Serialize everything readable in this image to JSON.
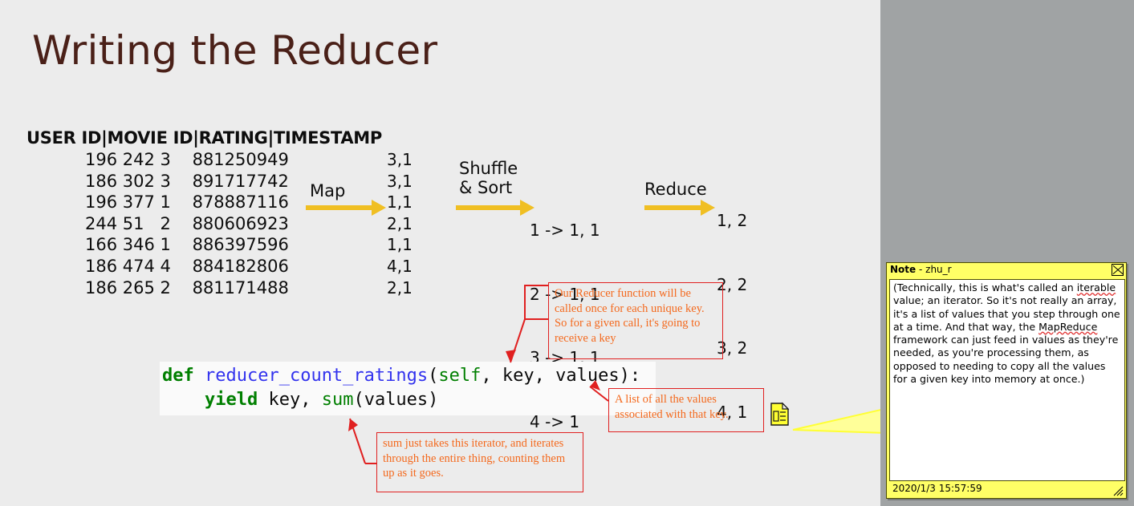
{
  "slide": {
    "title": "Writing the Reducer",
    "background_color": "#ececec",
    "title_color": "#4a2018"
  },
  "data_table": {
    "header": "USER ID|MOVIE ID|RATING|TIMESTAMP",
    "rows": [
      "196 242 3    881250949",
      "186 302 3    891717742",
      "196 377 1    878887116",
      "244 51   2    880606923",
      "166 346 1    886397596",
      "186 474 4    884182806",
      "186 265 2    881171488"
    ]
  },
  "pipeline": {
    "map_label": "Map",
    "shuffle_label": "Shuffle\n& Sort",
    "reduce_label": "Reduce",
    "arrow_color": "#f0bf23",
    "map_output": [
      "3,1",
      "3,1",
      "1,1",
      "2,1",
      "1,1",
      "4,1",
      "2,1"
    ],
    "shuffle_output": [
      "1 -> 1, 1",
      "2 -> 1, 1",
      "3 -> 1, 1",
      "4 -> 1"
    ],
    "reduce_output": [
      "1, 2",
      "2, 2",
      "3, 2",
      "4, 1"
    ]
  },
  "code": {
    "line1": {
      "def": "def",
      "fn": " reducer_count_ratings",
      "open": "(",
      "self": "self",
      "rest": ", key, values):"
    },
    "line2": {
      "indent": "    ",
      "yield": "yield",
      "mid": " key, ",
      "sum": "sum",
      "rest": "(values)"
    }
  },
  "annotations": [
    {
      "id": "note1",
      "text": "Our Reducer function will be called once for each unique key. So for a given call, it's going to receive a key"
    },
    {
      "id": "note2",
      "text": "A list of all the values associated with that key."
    },
    {
      "id": "note3",
      "text": "sum  just takes this iterator, and iterates through the entire thing, counting them up as it goes."
    }
  ],
  "annotation_colors": {
    "border": "#e02020",
    "text": "#f4691d"
  },
  "comment_panel": {
    "label": "Note",
    "separator": " - ",
    "author": "zhu_r",
    "close_icon": "close-icon",
    "body": "(Technically, this is what's called an iterable value; an iterator. So it's not really an array, it's a list of values that you step through one at a time. And that way, the MapReduce framework can just feed in values as they're needed, as you're processing them, as opposed to needing to copy all the values for a given key into memory at once.)",
    "timestamp": "2020/1/3 15:57:59",
    "background": "#ffff66"
  },
  "note_icon": {
    "name": "note-document-icon",
    "color": "#ffff33"
  }
}
